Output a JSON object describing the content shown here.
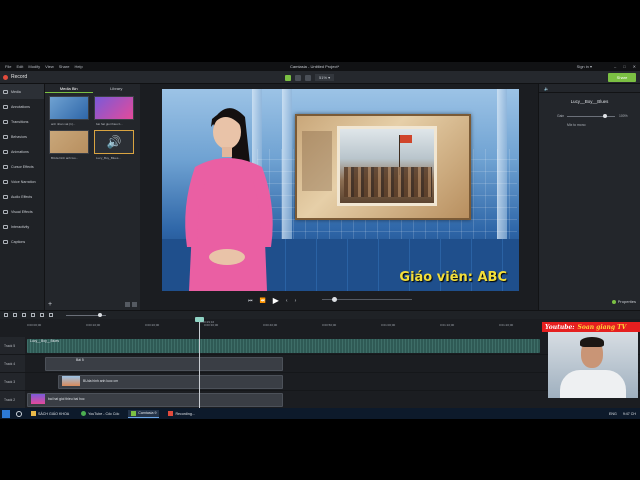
{
  "menubar": {
    "items": [
      "File",
      "Edit",
      "Modify",
      "View",
      "Share",
      "Help"
    ],
    "title": "Camtasia - Untitled Project*",
    "signin": "Sign in ▾",
    "window_controls": [
      "–",
      "□",
      "✕"
    ]
  },
  "toolbar": {
    "record_label": "Record",
    "zoom": "51% ▾",
    "share_label": "Share"
  },
  "leftnav": {
    "items": [
      "Media",
      "Annotations",
      "Transitions",
      "Behaviors",
      "Animations",
      "Cursor Effects",
      "Voice Narration",
      "Audio Effects",
      "Visual Effects",
      "Interactivity",
      "Captions"
    ]
  },
  "bin": {
    "tabs": [
      "Media Bin",
      "Library"
    ],
    "thumbs": [
      {
        "caption": "anh nhan vat (1)...",
        "icon": "video-thumb"
      },
      {
        "caption": "bai hat gioi thieu b...",
        "icon": "video-thumb"
      },
      {
        "caption": "BUda hinh anh luo...",
        "icon": "image-thumb"
      },
      {
        "caption": "Lucy_Boy_Blues...",
        "icon": "audio-thumb"
      }
    ]
  },
  "canvas": {
    "caption": "Giáo viên: ABC"
  },
  "playbar": {
    "buttons": [
      "⏮",
      "⏪",
      "▶",
      "‹",
      "›"
    ]
  },
  "props": {
    "header_icon": "speaker-icon",
    "clip_name": "Lucy__Boy__Blues",
    "gain_label": "Gain",
    "gain_value": "100%",
    "mix_label": "Mix to mono",
    "properties_label": "Properties"
  },
  "timeline": {
    "ruler_ticks": [
      "0:00:00;00",
      "0:00:10;00",
      "0:00:20;00",
      "0:00:30;00",
      "0:00:40;00",
      "0:00:50;00",
      "0:01:00;00",
      "0:01:10;00",
      "0:01:20;00",
      "0:01:30;00"
    ],
    "playhead_time": "0:00:29;16",
    "tracks": [
      {
        "label": "Track 5",
        "clip": "Lucy__Boy__Blues",
        "type": "audio"
      },
      {
        "label": "Track 4",
        "clip": "Bài 5",
        "type": "media"
      },
      {
        "label": "Track 3",
        "clip": "BUda hinh anh luoc cm",
        "type": "media"
      },
      {
        "label": "Track 2",
        "clip": "bai hat gioi thieu bai hoc",
        "type": "media"
      }
    ]
  },
  "overlay": {
    "youtube": "Youtube:",
    "channel": "Soan giang TV"
  },
  "taskbar": {
    "apps": [
      "SÁCH GIÁO KHOA",
      "YouTube - Cốc Cốc",
      "Camtasia 9",
      "Recording..."
    ],
    "tray": [
      "ENG",
      "9:47 CH"
    ]
  }
}
